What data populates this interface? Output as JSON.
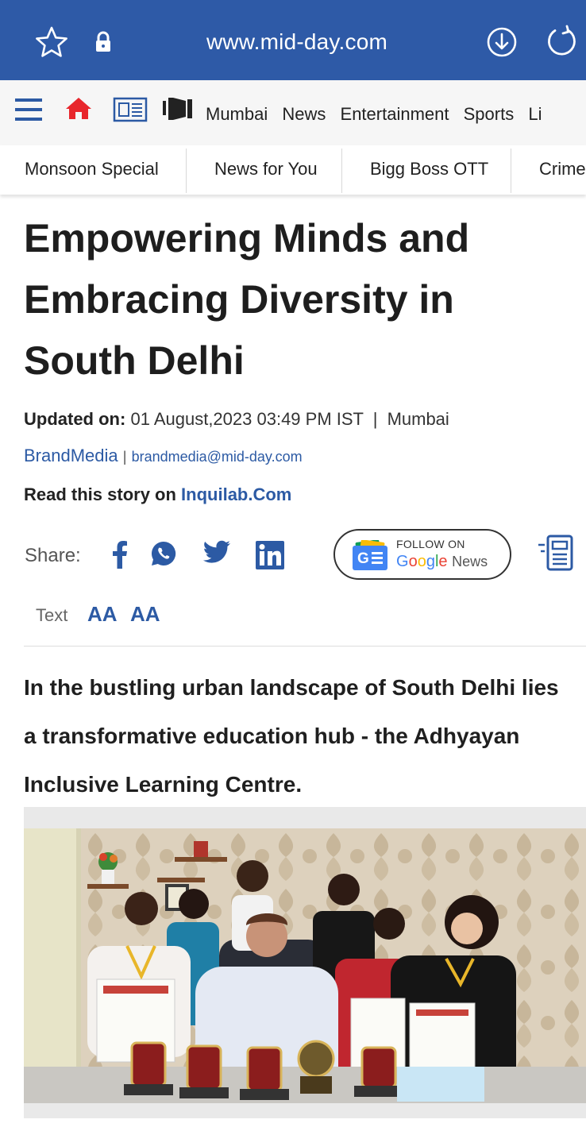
{
  "browser": {
    "url": "www.mid-day.com",
    "icons": [
      "star-icon",
      "lock-icon",
      "download-icon",
      "reload-icon"
    ]
  },
  "nav": {
    "links": [
      "Mumbai",
      "News",
      "Entertainment",
      "Sports",
      "Li"
    ],
    "icons": [
      "menu-icon",
      "home-icon",
      "epaper-icon",
      "podcast-icon"
    ]
  },
  "categories": [
    "Monsoon Special",
    "News for You",
    "Bigg Boss OTT",
    "Crime"
  ],
  "article": {
    "headline": "Empowering Minds and Embracing Diversity in South Delhi",
    "updated_label": "Updated on:",
    "updated_value": "01 August,2023 03:49 PM IST",
    "separator": "|",
    "location": "Mumbai",
    "author": "BrandMedia",
    "author_sep": "|",
    "author_email": "brandmedia@mid-day.com",
    "read_on_label": "Read this story on",
    "read_on_link": "Inquilab.Com",
    "share_label": "Share:",
    "share_icons": [
      "facebook-icon",
      "whatsapp-icon",
      "twitter-icon",
      "linkedin-icon"
    ],
    "google_news": {
      "line1": "FOLLOW ON",
      "brand_letters": [
        "G",
        "o",
        "o",
        "g",
        "l",
        "e"
      ],
      "brand_suffix": "News"
    },
    "text_label": "Text",
    "text_increase": "AA",
    "text_decrease": "AA",
    "lead": "In the bustling urban landscape of South Delhi lies a transformative education hub - the Adhyayan Inclusive Learning Centre."
  },
  "colors": {
    "browser_bar": "#2e5aa7",
    "link_blue": "#2c5aa4",
    "home_red": "#e8262c"
  }
}
